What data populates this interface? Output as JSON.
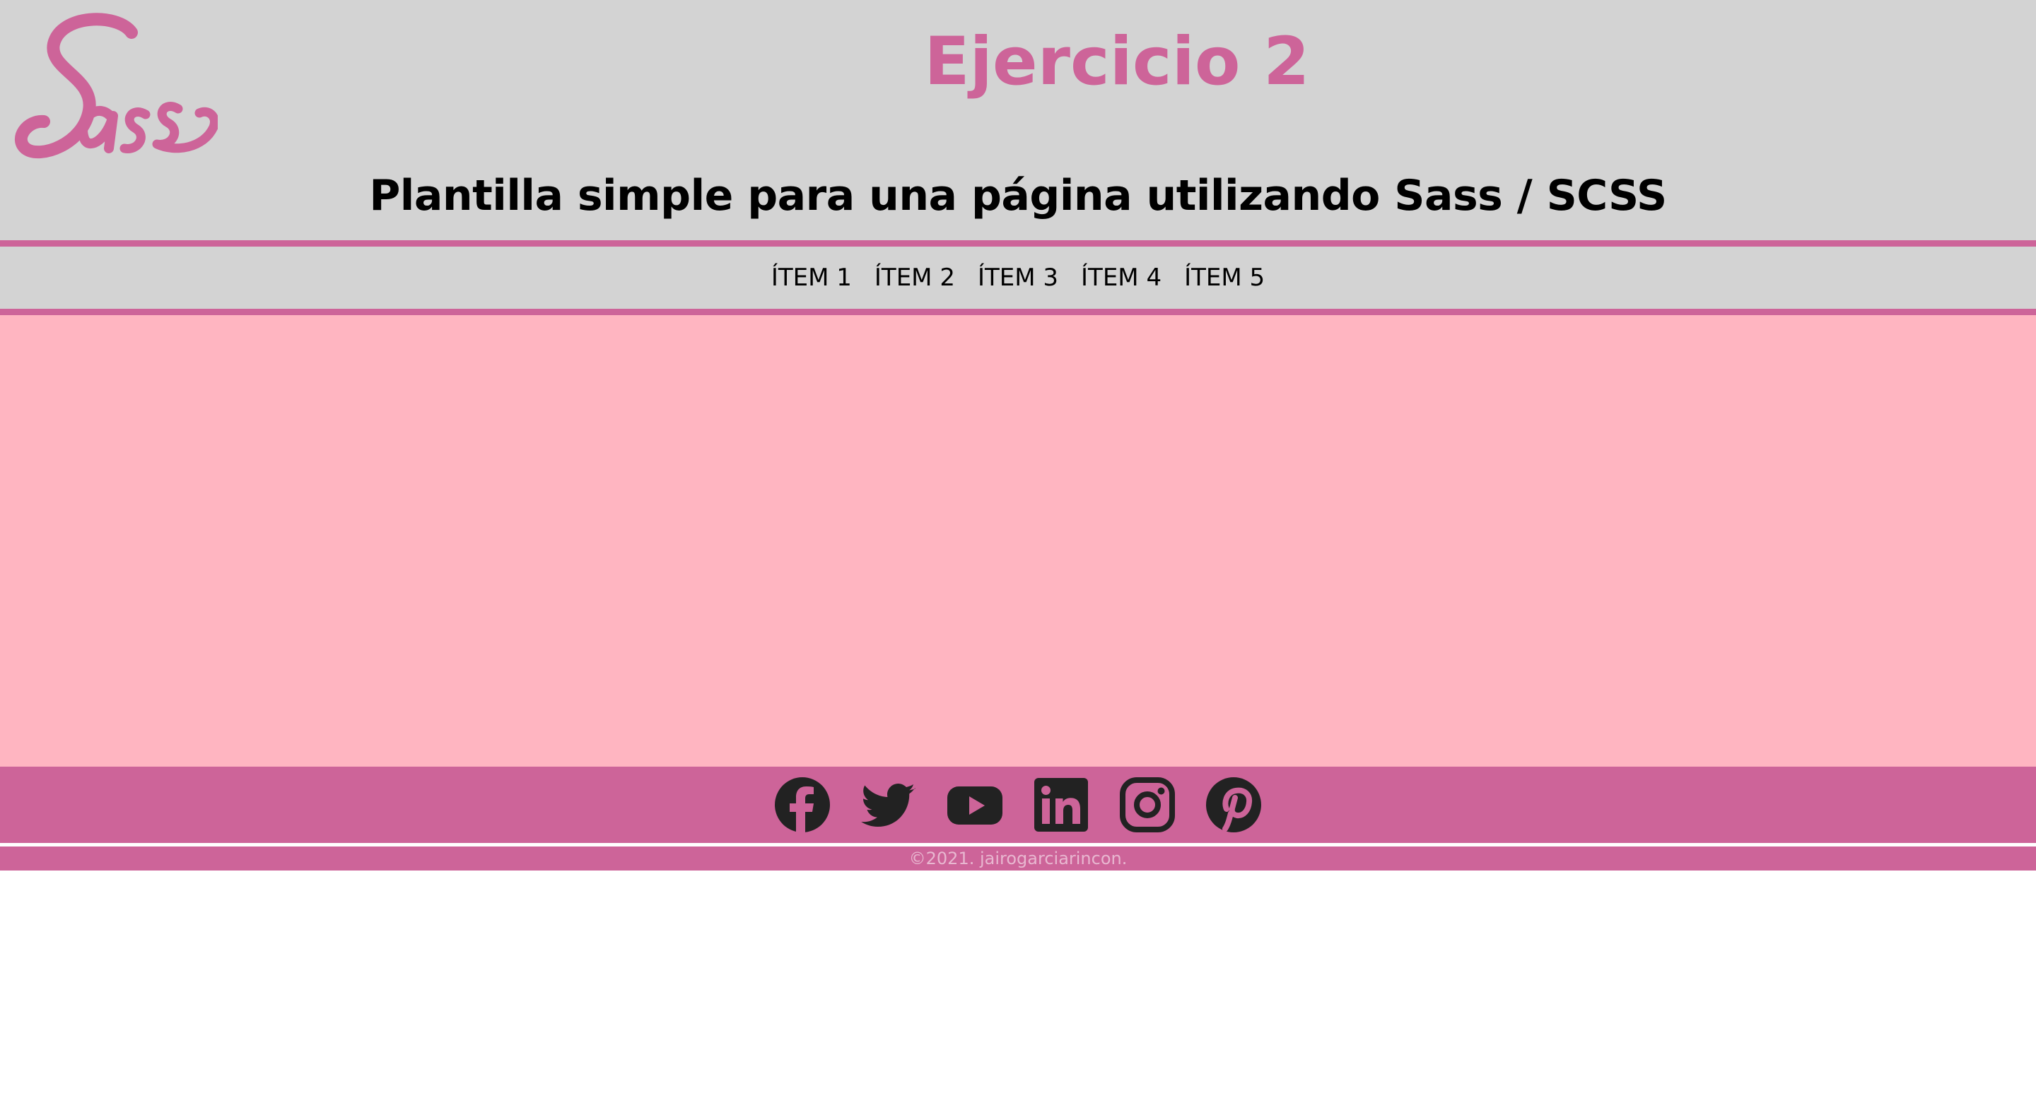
{
  "header": {
    "title": "Ejercicio 2",
    "subtitle": "Plantilla simple para una página utilizando Sass / SCSS",
    "logo_text": "Sass",
    "logo_color": "#cd6499"
  },
  "nav": {
    "items": [
      {
        "label": "ÍTEM 1"
      },
      {
        "label": "ÍTEM 2"
      },
      {
        "label": "ÍTEM 3"
      },
      {
        "label": "ÍTEM 4"
      },
      {
        "label": "ÍTEM 5"
      }
    ]
  },
  "social": {
    "icons": [
      "facebook-icon",
      "twitter-icon",
      "youtube-icon",
      "linkedin-icon",
      "instagram-icon",
      "pinterest-icon"
    ]
  },
  "footer": {
    "copyright": "©2021. jairogarciarincon."
  },
  "colors": {
    "accent": "#cd6499",
    "header_bg": "#d3d3d3",
    "main_bg": "#ffb5c1",
    "icon": "#222222"
  }
}
